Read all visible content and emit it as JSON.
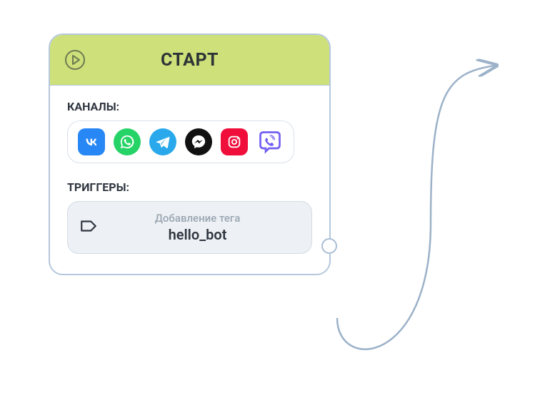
{
  "card": {
    "title": "СТАРТ",
    "channels_label": "КАНАЛЫ:",
    "triggers_label": "ТРИГГЕРЫ:"
  },
  "channels": [
    {
      "name": "vk",
      "bg": "#2787f5"
    },
    {
      "name": "whatsapp",
      "bg": "#25d366"
    },
    {
      "name": "telegram",
      "bg": "#29a9eb"
    },
    {
      "name": "messenger",
      "bg": "#111111"
    },
    {
      "name": "instagram",
      "bg": "#f00f3b"
    },
    {
      "name": "viber",
      "bg": "#ffffff"
    }
  ],
  "trigger": {
    "caption": "Добавление тега",
    "value": "hello_bot"
  },
  "colors": {
    "header_bg": "#cde07a",
    "border": "#b5c8dd",
    "connector": "#9cb2c9"
  }
}
